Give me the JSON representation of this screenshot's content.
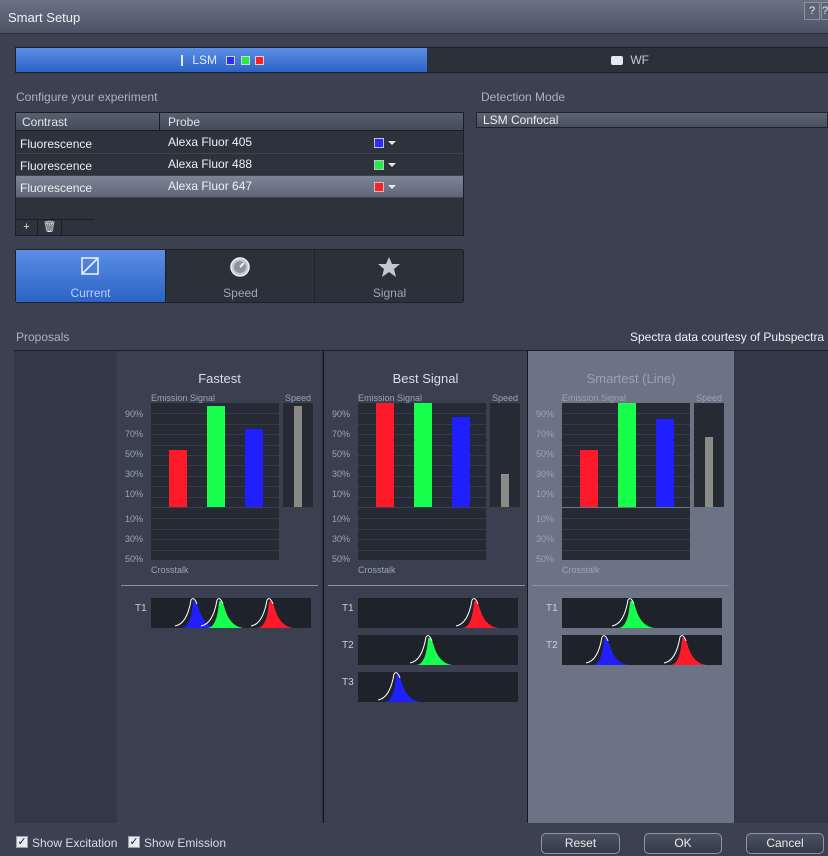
{
  "window": {
    "title": "Smart Setup",
    "help_label": "?",
    "extra_label": "?"
  },
  "mode_tabs": [
    {
      "label": "LSM",
      "swatches": [
        "#2b2bff",
        "#22ee44",
        "#ff2020"
      ]
    },
    {
      "label": "WF"
    }
  ],
  "configure": {
    "label": "Configure your experiment",
    "columns": [
      "Contrast",
      "Probe"
    ],
    "rows": [
      {
        "contrast": "Fluorescence",
        "probe": "Alexa Fluor 405",
        "color": "#2b2bff"
      },
      {
        "contrast": "Fluorescence",
        "probe": "Alexa Fluor 488",
        "color": "#22ee44"
      },
      {
        "contrast": "Fluorescence",
        "probe": "Alexa Fluor 647",
        "color": "#ff2020"
      }
    ],
    "add_label": "+",
    "delete_label": "🗑"
  },
  "detection": {
    "label": "Detection Mode",
    "value": "LSM Confocal"
  },
  "quality_buttons": [
    {
      "label": "Current",
      "icon": "current-frame-icon"
    },
    {
      "label": "Speed",
      "icon": "speedometer-icon"
    },
    {
      "label": "Signal",
      "icon": "star-icon"
    }
  ],
  "proposals": {
    "label": "Proposals",
    "credit": "Spectra data courtesy of Pubspectra",
    "emission_label": "Emission Signal",
    "speed_label": "Speed",
    "crosstalk_label": "Crosstalk",
    "top_ticks": [
      "90%",
      "70%",
      "50%",
      "30%",
      "10%"
    ],
    "bottom_ticks": [
      "10%",
      "30%",
      "50%"
    ],
    "columns": [
      {
        "title": "Fastest",
        "bars": [
          0.55,
          0.97,
          0.75
        ],
        "speed": 0.97,
        "tracks": [
          "T1"
        ]
      },
      {
        "title": "Best Signal",
        "bars": [
          1.0,
          1.0,
          0.87
        ],
        "speed": 0.32,
        "tracks": [
          "T1",
          "T2",
          "T3"
        ]
      },
      {
        "title": "Smartest (Line)",
        "bars": [
          0.55,
          1.0,
          0.85
        ],
        "speed": 0.67,
        "tracks": [
          "T1",
          "T2"
        ]
      }
    ]
  },
  "footer": {
    "show_excitation": "Show Excitation",
    "show_emission": "Show Emission",
    "reset": "Reset",
    "ok": "OK",
    "cancel": "Cancel"
  }
}
